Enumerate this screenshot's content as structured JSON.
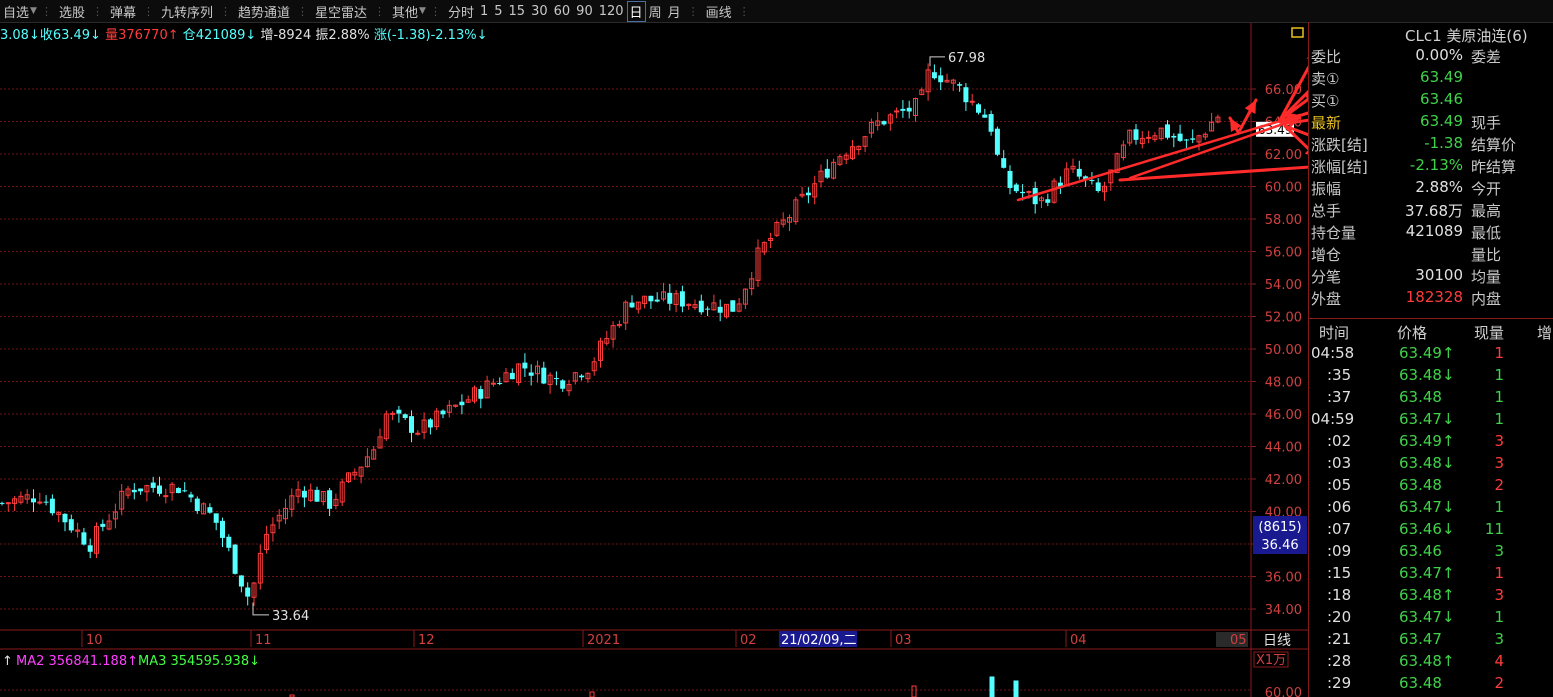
{
  "toolbar": {
    "items": [
      {
        "label": "自选",
        "dropdown": true,
        "active": true
      },
      {
        "label": "选股"
      },
      {
        "label": "弹幕"
      },
      {
        "label": "九转序列"
      },
      {
        "label": "趋势通道"
      },
      {
        "label": "星空雷达"
      },
      {
        "label": "其他",
        "dropdown": true
      }
    ],
    "periods": [
      "分时",
      "1",
      "5",
      "15",
      "30",
      "60",
      "90",
      "120",
      "日",
      "周",
      "月"
    ],
    "active_period": "日",
    "draw": "画线"
  },
  "infobar": {
    "open_tail": "3.08↓",
    "close": "收63.49↓",
    "volume": "量376770↑",
    "position": "仓421089↓",
    "increase": "增-8924",
    "amplitude": "振2.88%",
    "change": "涨(-1.38)-2.13%↓"
  },
  "chart": {
    "y_ticks": [
      "66.00",
      "64.00",
      "62.00",
      "60.00",
      "58.00",
      "56.00",
      "54.00",
      "52.00",
      "50.00",
      "48.00",
      "46.00",
      "44.00",
      "42.00",
      "40.00",
      "38.00",
      "36.00",
      "34.00"
    ],
    "x_labels": [
      "10",
      "11",
      "12",
      "2021",
      "02",
      "03",
      "04"
    ],
    "x_last": "05",
    "period_label": "日线",
    "cursor_date": "21/02/09,二",
    "cursor_box_top": "(8615)",
    "cursor_box_bottom": "36.46",
    "high_label": "67.98",
    "low_label": "33.64",
    "current_price_tag": "63.49",
    "vol_scale": "X1万",
    "vol_tick": "60.00",
    "ma_line": {
      "ma1_tail": "↑",
      "ma2": "MA2 356841.188↑",
      "ma3": "MA3 354595.938↓"
    },
    "colors": {
      "up": "#ff3c3c",
      "down": "#54ffff",
      "grid": "#6e1414",
      "arrow": "#ff2a2a"
    }
  },
  "quote": {
    "title": "CLc1 美原油连(6)",
    "rows": [
      {
        "label": "委比",
        "value": "0.00%",
        "label2": "委差",
        "color": "#e0e0e0"
      },
      {
        "label": "卖①",
        "value": "63.49",
        "label2": "",
        "color": "#3fd24a"
      },
      {
        "label": "买①",
        "value": "63.46",
        "label2": "",
        "color": "#3fd24a"
      },
      {
        "label": "最新",
        "value": "63.49",
        "label2": "现手",
        "color": "#3fd24a",
        "label_color": "#e8c020"
      },
      {
        "label": "涨跌[结]",
        "value": "-1.38",
        "label2": "结算价",
        "color": "#3fd24a"
      },
      {
        "label": "涨幅[结]",
        "value": "-2.13%",
        "label2": "昨结算",
        "color": "#3fd24a"
      },
      {
        "label": "振幅",
        "value": "2.88%",
        "label2": "今开",
        "color": "#e0e0e0"
      },
      {
        "label": "总手",
        "value": "37.68万",
        "label2": "最高",
        "color": "#e0e0e0"
      },
      {
        "label": "持仓量",
        "value": "421089",
        "label2": "最低",
        "color": "#e0e0e0"
      },
      {
        "label": "增仓",
        "value": "",
        "label2": "量比",
        "color": "#e0e0e0"
      },
      {
        "label": "分笔",
        "value": "30100",
        "label2": "均量",
        "color": "#e0e0e0"
      },
      {
        "label": "外盘",
        "value": "182328",
        "label2": "内盘",
        "color": "#ff3c3c"
      }
    ]
  },
  "ticks": {
    "headers": [
      "时间",
      "价格",
      "现量",
      "增"
    ],
    "rows": [
      {
        "time": "04:58",
        "price": "63.49↑",
        "qty": "1",
        "pc": "#3fd24a",
        "qc": "#ff3c3c"
      },
      {
        "time": ":35",
        "price": "63.48↓",
        "qty": "1",
        "pc": "#3fd24a",
        "qc": "#3fd24a"
      },
      {
        "time": ":37",
        "price": "63.48",
        "qty": "1",
        "pc": "#3fd24a",
        "qc": "#3fd24a"
      },
      {
        "time": "04:59",
        "price": "63.47↓",
        "qty": "1",
        "pc": "#3fd24a",
        "qc": "#3fd24a"
      },
      {
        "time": ":02",
        "price": "63.49↑",
        "qty": "3",
        "pc": "#3fd24a",
        "qc": "#ff3c3c"
      },
      {
        "time": ":03",
        "price": "63.48↓",
        "qty": "3",
        "pc": "#3fd24a",
        "qc": "#ff3c3c"
      },
      {
        "time": ":05",
        "price": "63.48",
        "qty": "2",
        "pc": "#3fd24a",
        "qc": "#ff3c3c"
      },
      {
        "time": ":06",
        "price": "63.47↓",
        "qty": "1",
        "pc": "#3fd24a",
        "qc": "#3fd24a"
      },
      {
        "time": ":07",
        "price": "63.46↓",
        "qty": "11",
        "pc": "#3fd24a",
        "qc": "#3fd24a"
      },
      {
        "time": ":09",
        "price": "63.46",
        "qty": "3",
        "pc": "#3fd24a",
        "qc": "#3fd24a"
      },
      {
        "time": ":15",
        "price": "63.47↑",
        "qty": "1",
        "pc": "#3fd24a",
        "qc": "#ff3c3c"
      },
      {
        "time": ":18",
        "price": "63.48↑",
        "qty": "3",
        "pc": "#3fd24a",
        "qc": "#ff3c3c"
      },
      {
        "time": ":20",
        "price": "63.47↓",
        "qty": "1",
        "pc": "#3fd24a",
        "qc": "#3fd24a"
      },
      {
        "time": ":21",
        "price": "63.47",
        "qty": "3",
        "pc": "#3fd24a",
        "qc": "#3fd24a"
      },
      {
        "time": ":28",
        "price": "63.48↑",
        "qty": "4",
        "pc": "#3fd24a",
        "qc": "#ff3c3c"
      },
      {
        "time": ":29",
        "price": "63.48",
        "qty": "2",
        "pc": "#3fd24a",
        "qc": "#ff3c3c"
      }
    ]
  }
}
